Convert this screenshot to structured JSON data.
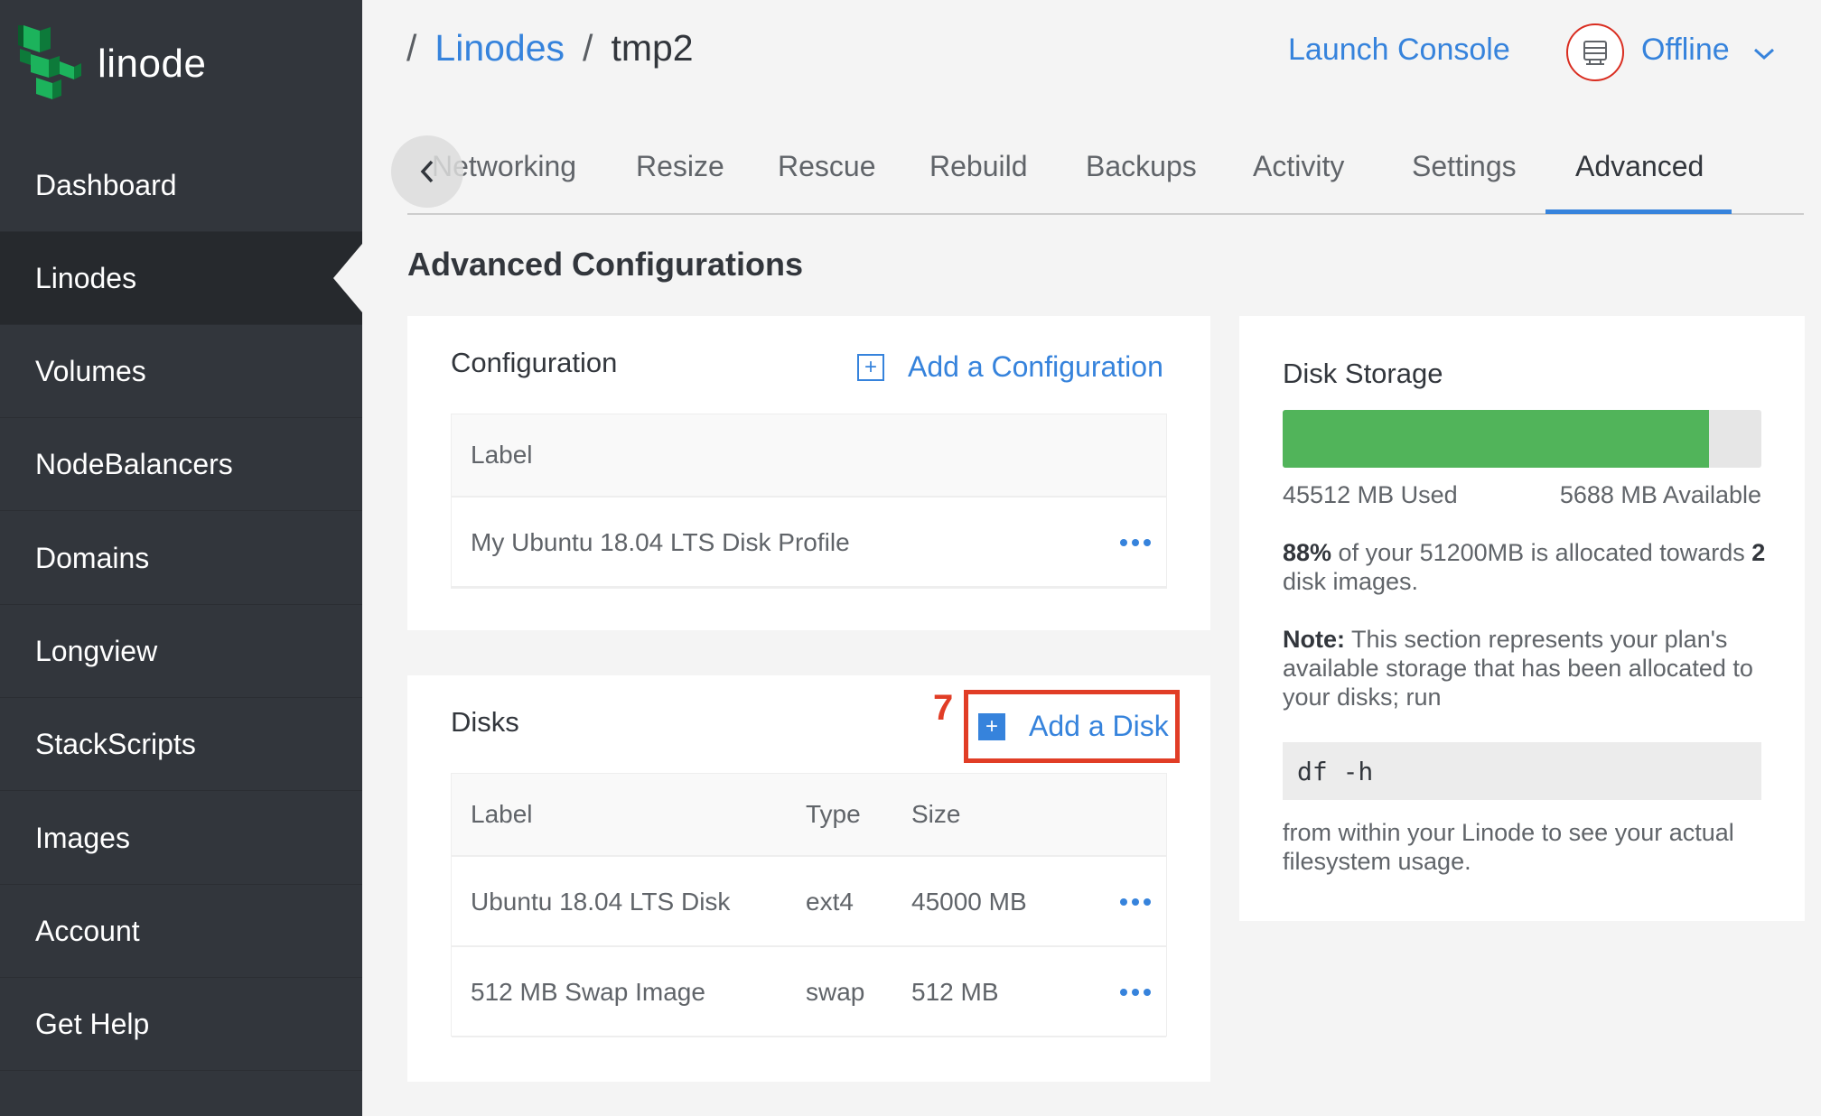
{
  "brand": {
    "name": "linode"
  },
  "sidebar": {
    "items": [
      {
        "label": "Dashboard"
      },
      {
        "label": "Linodes"
      },
      {
        "label": "Volumes"
      },
      {
        "label": "NodeBalancers"
      },
      {
        "label": "Domains"
      },
      {
        "label": "Longview"
      },
      {
        "label": "StackScripts"
      },
      {
        "label": "Images"
      },
      {
        "label": "Account"
      },
      {
        "label": "Get Help"
      }
    ],
    "active_index": 1
  },
  "header": {
    "breadcrumb_sep": "/",
    "breadcrumb_link": "Linodes",
    "breadcrumb_current": "tmp2",
    "launch_console": "Launch Console",
    "status": "Offline"
  },
  "tabs": [
    {
      "label": "Networking"
    },
    {
      "label": "Resize"
    },
    {
      "label": "Rescue"
    },
    {
      "label": "Rebuild"
    },
    {
      "label": "Backups"
    },
    {
      "label": "Activity"
    },
    {
      "label": "Settings"
    },
    {
      "label": "Advanced"
    }
  ],
  "page_title": "Advanced Configurations",
  "configuration": {
    "title": "Configuration",
    "add_label": "Add a Configuration",
    "columns": [
      "Label"
    ],
    "rows": [
      {
        "label": "My Ubuntu 18.04 LTS Disk Profile"
      }
    ]
  },
  "disks": {
    "title": "Disks",
    "add_label": "Add a Disk",
    "annotation": "7",
    "columns": [
      "Label",
      "Type",
      "Size"
    ],
    "rows": [
      {
        "label": "Ubuntu 18.04 LTS Disk",
        "type": "ext4",
        "size": "45000 MB"
      },
      {
        "label": "512 MB Swap Image",
        "type": "swap",
        "size": "512 MB"
      }
    ]
  },
  "disk_storage": {
    "title": "Disk Storage",
    "used_fraction": 0.89,
    "used": "45512 MB Used",
    "available": "5688 MB Available",
    "alloc_percent": "88%",
    "alloc_mid": " of your 51200MB is allocated towards ",
    "alloc_count": "2",
    "alloc_end": " disk images.",
    "note_label": "Note:",
    "note_text": " This section represents your plan's available storage that has been allocated to your disks; run",
    "command": "df -h",
    "footer": "from within your Linode to see your actual filesystem usage."
  },
  "colors": {
    "accent": "#3683dc",
    "sidebar": "#32363c",
    "bar": "#51b45a",
    "annotation": "#e13d26"
  }
}
